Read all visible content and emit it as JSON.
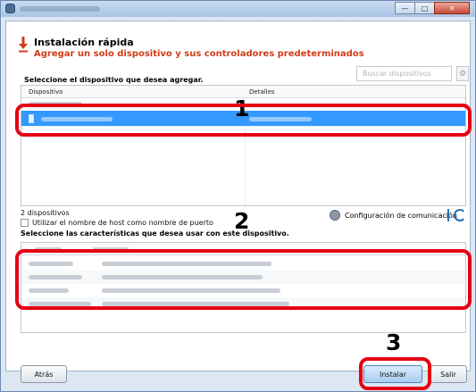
{
  "window": {
    "controls": {
      "minimize": "—",
      "maximize": "□",
      "close": "✕"
    }
  },
  "header": {
    "title": "Instalación rápida",
    "subtitle": "Agregar un solo dispositivo y sus controladores predeterminados"
  },
  "search": {
    "placeholder": "Buscar dispositivos",
    "icon": "search-icon",
    "button_glyph": "⚙"
  },
  "devices": {
    "label": "Seleccione el dispositivo que desea agregar.",
    "columns": [
      "Dispositivo",
      "Detalles"
    ],
    "count": "2 dispositivos",
    "selected_index": 1
  },
  "options": {
    "hostname_checkbox": "Utilizar el nombre de host como nombre de puerto",
    "hostname_checked": false,
    "comm_settings": "Configuración de comunicación"
  },
  "features": {
    "label": "Seleccione las características que desea usar con este dispositivo."
  },
  "callouts": [
    "1",
    "2",
    "3"
  ],
  "buttons": {
    "back": "Atrás",
    "install": "Instalar",
    "exit": "Salir"
  },
  "colors": {
    "accent": "#d23b18",
    "selection": "#3399ff",
    "callout": "#e60012",
    "link": "#2b6fb3"
  }
}
